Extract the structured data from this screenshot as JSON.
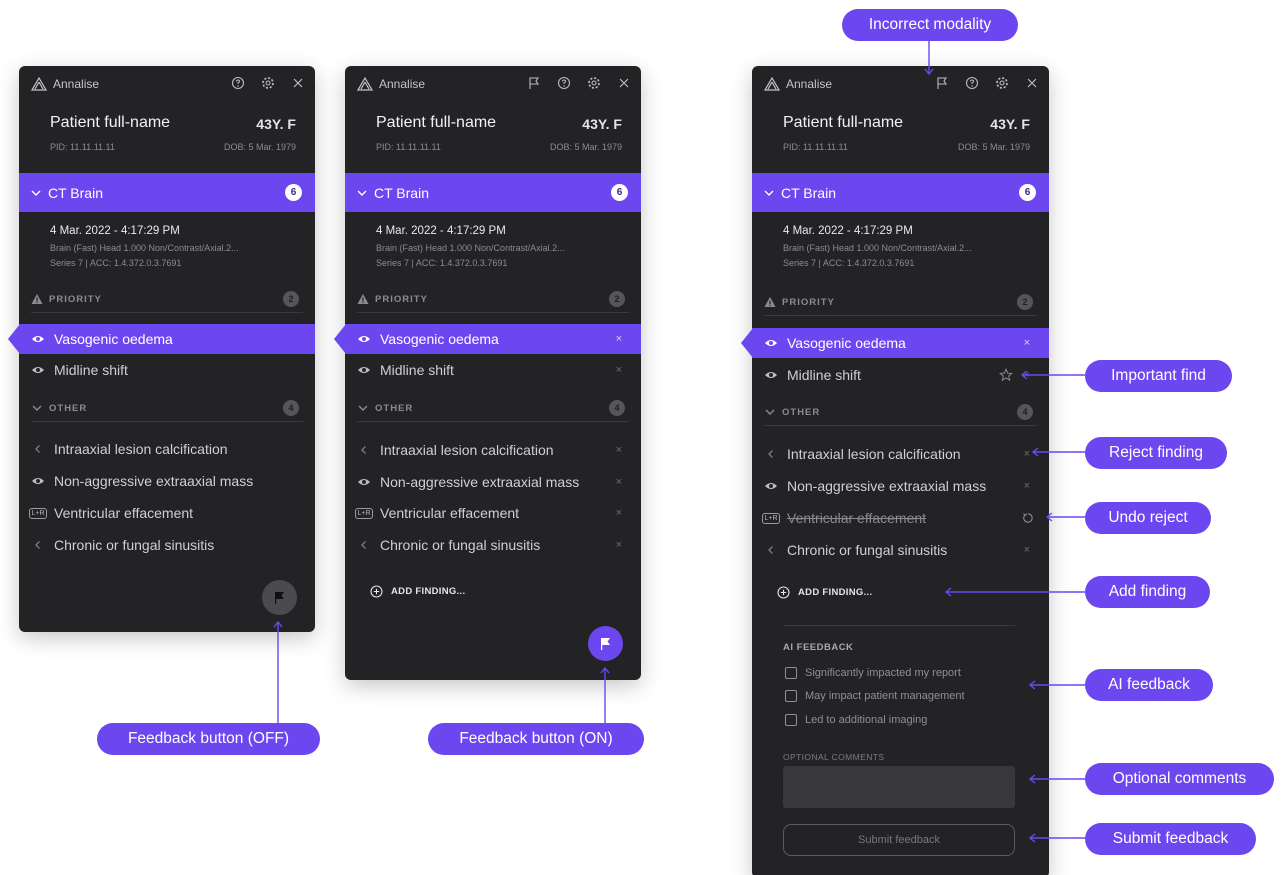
{
  "app": {
    "brand": "Annalise"
  },
  "patient": {
    "name": "Patient full-name",
    "age_sex": "43Y. F",
    "pid": "PID: 11.11.11.11",
    "dob": "DOB: 5 Mar. 1979"
  },
  "study": {
    "title": "CT Brain",
    "count": "6",
    "date": "4 Mar. 2022 - 4:17:29 PM",
    "description": "Brain (Fast) Head 1.000 Non/Contrast/Axial.2...",
    "series": "Series 7  |  ACC: 1.4.372.0.3.7691"
  },
  "priority": {
    "label": "PRIORITY",
    "count": "2",
    "findings": [
      "Vasogenic oedema",
      "Midline shift"
    ]
  },
  "other": {
    "label": "OTHER",
    "count": "4",
    "findings": [
      "Intraaxial lesion calcification",
      "Non-aggressive extraaxial mass",
      "Ventricular effacement",
      "Chronic or fungal sinusitis"
    ]
  },
  "add_finding": "ADD FINDING...",
  "close_mark": "×",
  "lr_badge": "L+R",
  "ai_feedback": {
    "title": "AI FEEDBACK",
    "options": [
      "Significantly impacted my report",
      "May impact patient management",
      "Led to additional imaging"
    ],
    "comments_label": "OPTIONAL COMMENTS",
    "submit": "Submit feedback"
  },
  "callouts": {
    "incorrect_modality": "Incorrect modality",
    "important_find": "Important find",
    "reject_finding": "Reject finding",
    "undo_reject": "Undo reject",
    "add_finding": "Add finding",
    "ai_feedback": "AI feedback",
    "optional_comments": "Optional comments",
    "submit_feedback": "Submit feedback",
    "feedback_off": "Feedback button (OFF)",
    "feedback_on": "Feedback button (ON)"
  },
  "colors": {
    "accent": "#6c47f0",
    "panel": "#232325",
    "fab_off": "#4a4a4f"
  },
  "icons": [
    "annalise-logo-icon",
    "flag-icon",
    "help-icon",
    "gear-icon",
    "close-icon",
    "chevron-down-icon",
    "warning-icon",
    "eye-icon",
    "chevron-left-icon",
    "lr-icon",
    "add-circle-icon",
    "star-icon",
    "undo-icon"
  ]
}
